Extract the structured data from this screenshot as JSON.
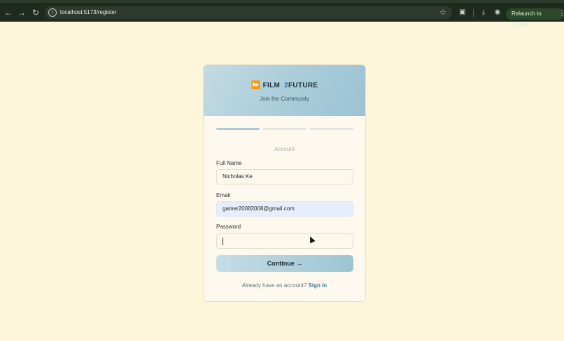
{
  "browser": {
    "url": "localhost:5173/register",
    "relaunch_label": "Relaunch to update",
    "icons": {
      "back": "back-arrow-icon",
      "forward": "forward-arrow-icon",
      "reload": "reload-icon",
      "info": "site-info-icon",
      "star": "bookmark-star-icon",
      "reading": "reading-mode-icon",
      "download": "download-icon",
      "profile": "profile-icon",
      "menu": "kebab-menu-icon"
    }
  },
  "brand": {
    "name_part1": "FILM",
    "name_number": "2",
    "name_part2": "FUTURE",
    "tagline": "Join the Community"
  },
  "steps": {
    "active_index": 0,
    "count": 3,
    "current_label": "Account"
  },
  "form": {
    "full_name_label": "Full Name",
    "full_name_value": "Nicholas Ke",
    "email_label": "Email",
    "email_value": "gamer20082008@gmail.com",
    "password_label": "Password",
    "password_value": "",
    "continue_label": "Continue →"
  },
  "footer": {
    "prompt": "Already have an account?",
    "signin_label": "Sign in"
  },
  "colors": {
    "page_bg": "#fdf6da",
    "header_gradient_start": "#c3dbe3",
    "header_gradient_end": "#9cc3d3",
    "accent_link": "#3f7c94",
    "brand_number": "#2f6fb8"
  }
}
